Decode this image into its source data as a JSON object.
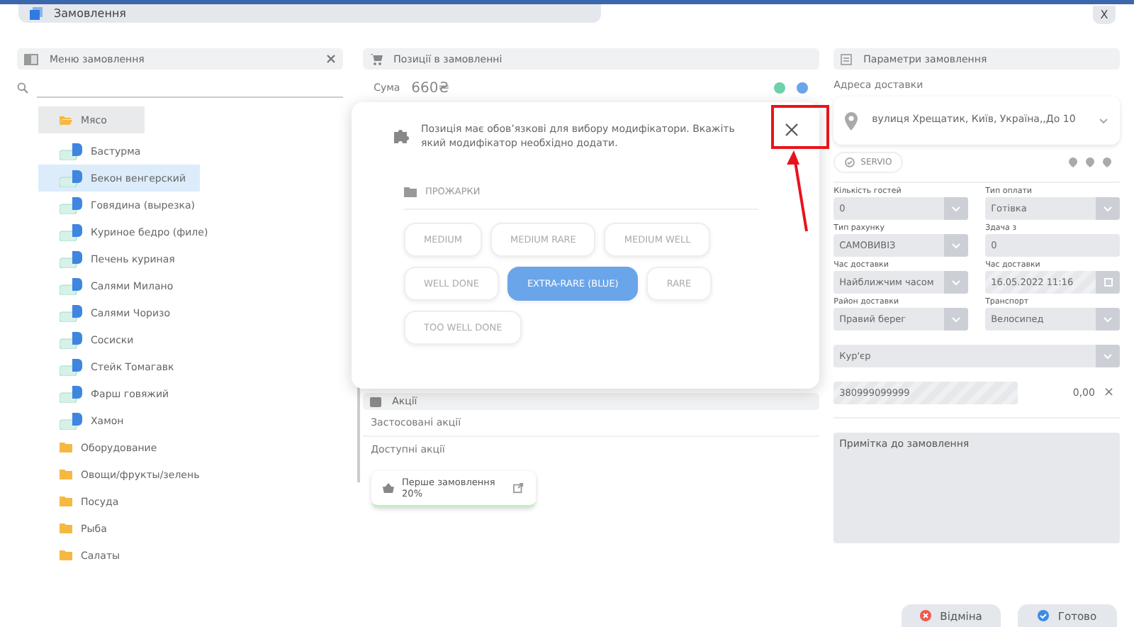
{
  "window": {
    "title": "Замовлення",
    "close": "X"
  },
  "menu": {
    "title": "Меню замовлення",
    "categories": [
      {
        "name": "Мясо",
        "expanded": true,
        "children": [
          {
            "name": "Бастурма",
            "selected": false
          },
          {
            "name": "Бекон венгерский",
            "selected": true
          },
          {
            "name": "Говядина (вырезка)",
            "selected": false
          },
          {
            "name": "Куриное бедро (филе)",
            "selected": false
          },
          {
            "name": "Печень куриная",
            "selected": false
          },
          {
            "name": "Салями Милано",
            "selected": false
          },
          {
            "name": "Салями Чоризо",
            "selected": false
          },
          {
            "name": "Сосиски",
            "selected": false
          },
          {
            "name": "Стейк Томагавк",
            "selected": false
          },
          {
            "name": "Фарш говяжий",
            "selected": false
          },
          {
            "name": "Хамон",
            "selected": false
          }
        ]
      },
      {
        "name": "Оборудование",
        "expanded": false
      },
      {
        "name": "Овощи/фрукты/зелень",
        "expanded": false
      },
      {
        "name": "Посуда",
        "expanded": false
      },
      {
        "name": "Рыба",
        "expanded": false
      },
      {
        "name": "Салаты",
        "expanded": false
      }
    ]
  },
  "order": {
    "title": "Позиції в замовленні",
    "sum_label": "Сума",
    "sum": "660₴",
    "promotions": {
      "title": "Акції",
      "applied": "Застосовані акції",
      "available": "Доступні акції",
      "offers": [
        {
          "name": "Перше замовлення 20%"
        }
      ]
    }
  },
  "params": {
    "title": "Параметри замовлення",
    "address_label": "Адреса доставки",
    "address": "вулиця Хрещатик, Київ, Україна,,До 10",
    "servio": "SERVIO",
    "fields": [
      {
        "label": "Кількість гостей",
        "value": "0",
        "kind": "select"
      },
      {
        "label": "Тип оплати",
        "value": "Готівка",
        "kind": "select"
      },
      {
        "label": "Тип рахунку",
        "value": "САМОВИВІЗ",
        "kind": "select"
      },
      {
        "label": "Здача з",
        "value": "0",
        "kind": "input"
      },
      {
        "label": "Час доставки",
        "value": "Найближчим часом",
        "kind": "select"
      },
      {
        "label": "Час доставки",
        "value": "16.05.2022 11:16",
        "kind": "date"
      },
      {
        "label": "Район доставки",
        "value": "Правий берег",
        "kind": "select"
      },
      {
        "label": "Транспорт",
        "value": "Велосипед",
        "kind": "select"
      }
    ],
    "courier": "Кур'єр",
    "phone": "380999099999",
    "amount": "0,00",
    "clear": "×",
    "note_placeholder": "Примітка до замовлення"
  },
  "dialog": {
    "message": "Позиція має обов’язкові для вибору модифікатори. Вкажіть який модифікатор необхідно додати.",
    "group": "ПРОЖАРКИ",
    "options": [
      {
        "label": "MEDIUM",
        "selected": false
      },
      {
        "label": "MEDIUM RARE",
        "selected": false
      },
      {
        "label": "MEDIUM WELL",
        "selected": false
      },
      {
        "label": "WELL DONE",
        "selected": false
      },
      {
        "label": "EXTRA-RARE (BLUE)",
        "selected": true
      },
      {
        "label": "RARE",
        "selected": false
      },
      {
        "label": "TOO WELL DONE",
        "selected": false
      }
    ]
  },
  "footer": {
    "cancel": "Відміна",
    "done": "Готово"
  }
}
